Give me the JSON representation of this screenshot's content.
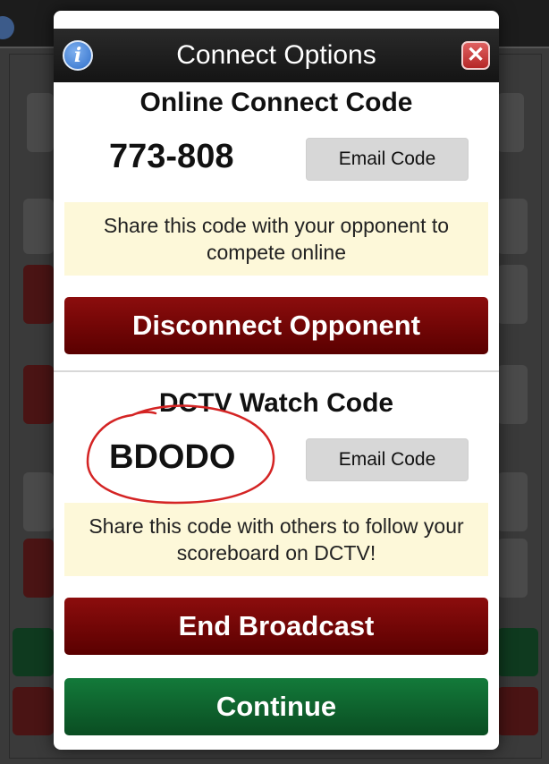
{
  "header": {
    "title": "Connect Options",
    "info_icon": "info-icon",
    "close_icon": "close-icon",
    "close_symbol": "✕"
  },
  "online": {
    "title": "Online Connect Code",
    "code": "773-808",
    "email_label": "Email Code",
    "note": "Share this code with your opponent to compete online",
    "disconnect_label": "Disconnect Opponent"
  },
  "dctv": {
    "title": "DCTV Watch Code",
    "code": "BDODO",
    "email_label": "Email Code",
    "note": "Share this code with others to follow your scoreboard on DCTV!",
    "end_label": "End Broadcast"
  },
  "footer": {
    "continue_label": "Continue"
  },
  "colors": {
    "red_button": "#7a0505",
    "green_button": "#0e6030",
    "note_bg": "#fdf8d9",
    "annotation": "#d42424"
  }
}
